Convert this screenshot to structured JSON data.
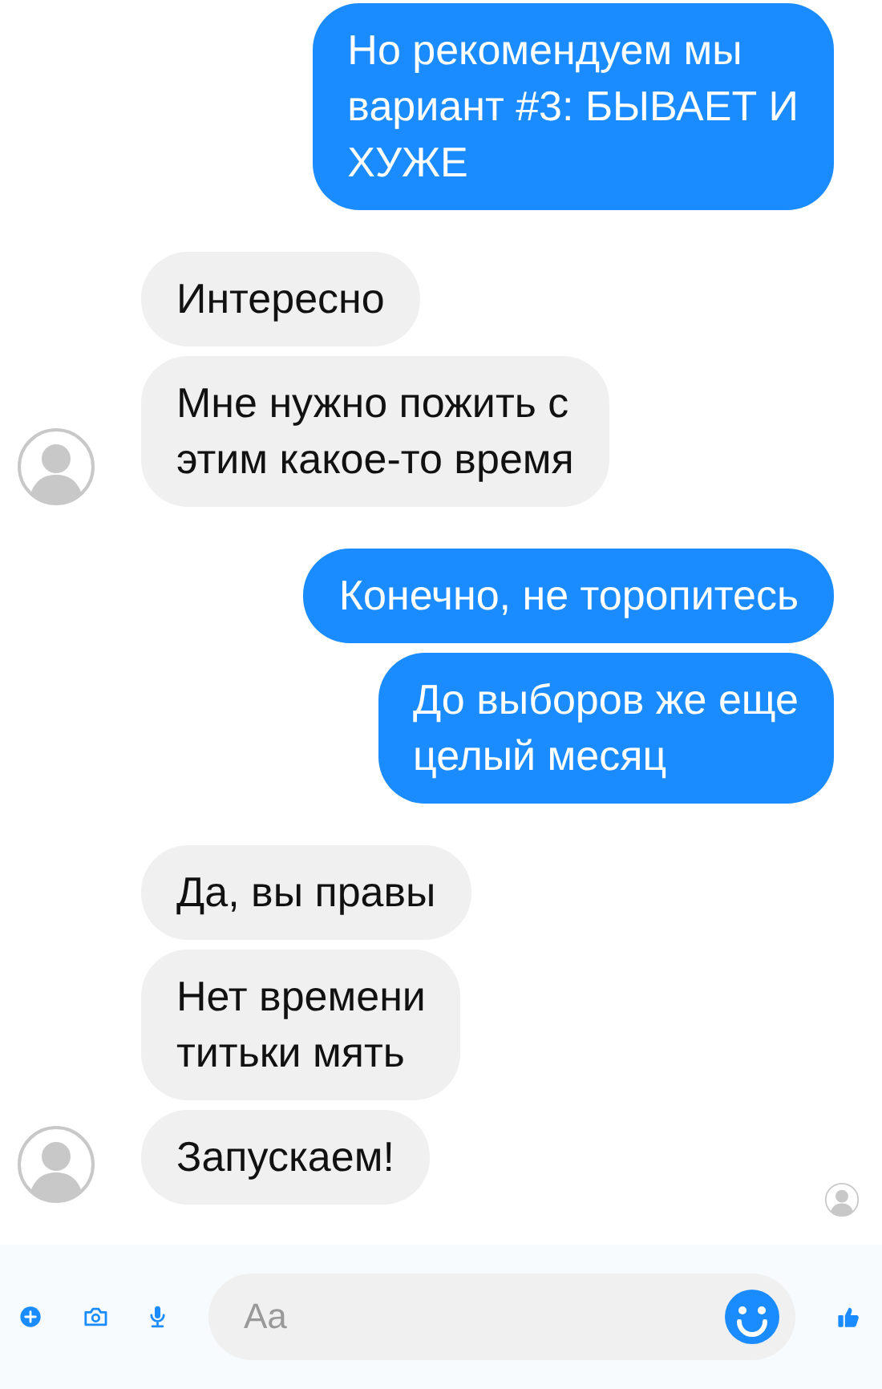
{
  "messages": [
    {
      "kind": "out",
      "text": "Но рекомендуем мы\nвариант #3: БЫВАЕТ И\nХУЖЕ"
    },
    {
      "kind": "in",
      "text": "Интересно",
      "avatar": false
    },
    {
      "kind": "in",
      "text": "Мне нужно пожить с\nэтим какое-то время",
      "avatar": true
    },
    {
      "kind": "out",
      "text": "Конечно, не торопитесь"
    },
    {
      "kind": "out",
      "text": "До выборов же еще\nцелый месяц"
    },
    {
      "kind": "in",
      "text": "Да, вы правы",
      "avatar": false
    },
    {
      "kind": "in",
      "text": "Нет времени\nтитьки мять",
      "avatar": false
    },
    {
      "kind": "in",
      "text": "Запускаем!",
      "avatar": true,
      "seen": true
    }
  ],
  "composer": {
    "placeholder": "Aa"
  }
}
